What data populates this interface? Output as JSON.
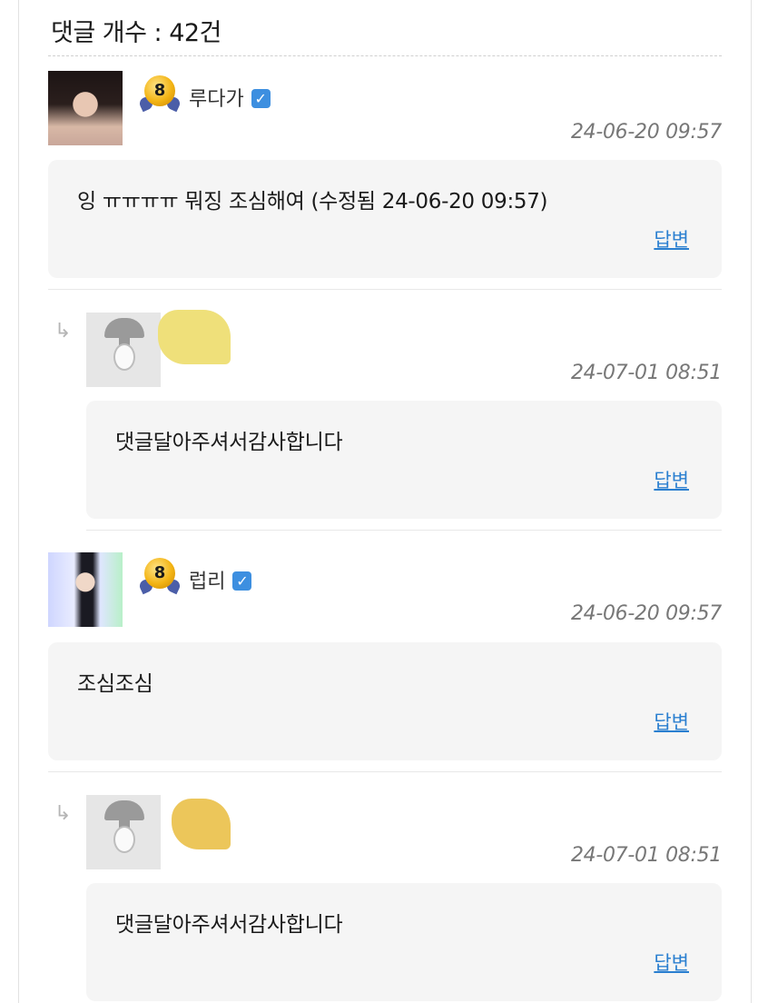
{
  "header": {
    "count_label": "댓글 개수 : 42건"
  },
  "comments": [
    {
      "level": "8",
      "nickname": "루다가",
      "verified_icon": "check-icon",
      "time": "24-06-20 09:57",
      "content": "잉 ㅠㅠㅠㅠ 뭐징 조심해여 (수정됨 24-06-20 09:57)",
      "reply_label": "답변"
    },
    {
      "is_reply": true,
      "reply_icon": "reply-arrow-icon",
      "avatar": "default-avatar",
      "nickname_hidden_color": "#efe07a",
      "time": "24-07-01 08:51",
      "content": "댓글달아주셔서감사합니다",
      "reply_label": "답변"
    },
    {
      "level": "8",
      "nickname": "럽리",
      "verified_icon": "check-icon",
      "time": "24-06-20 09:57",
      "content": "조심조심",
      "reply_label": "답변"
    },
    {
      "is_reply": true,
      "reply_icon": "reply-arrow-icon",
      "avatar": "default-avatar",
      "nickname_hidden_color": "#ecc65a",
      "time": "24-07-01 08:51",
      "content": "댓글달아주셔서감사합니다",
      "reply_label": "답변"
    }
  ],
  "colors": {
    "link": "#2a7fd0",
    "bubble_bg": "#f5f5f5",
    "verified": "#3d8fe0",
    "level_badge": "#f3b414"
  }
}
